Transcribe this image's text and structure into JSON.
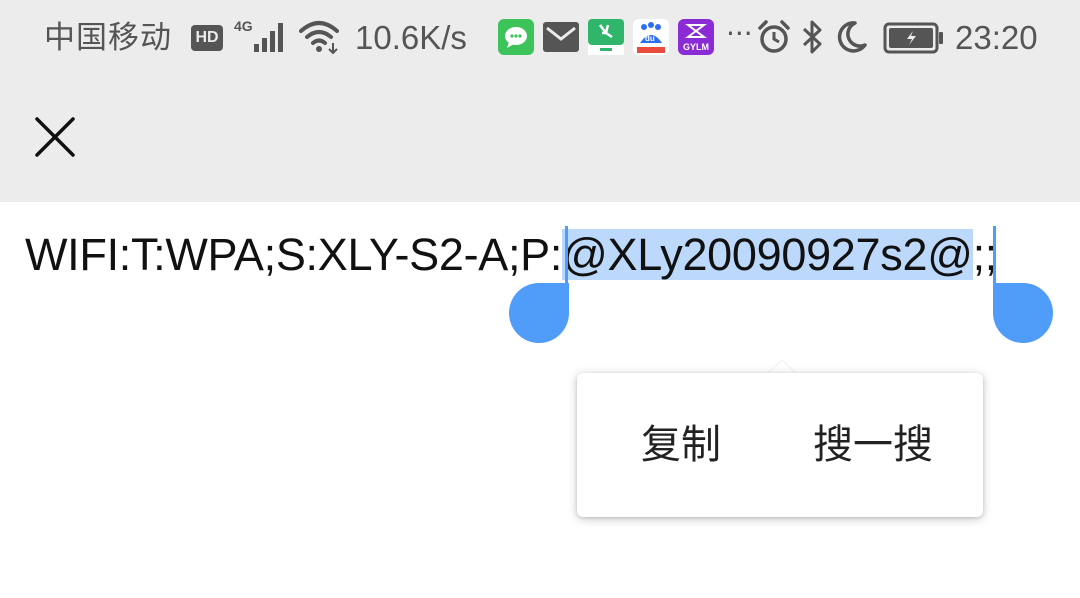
{
  "status_bar": {
    "carrier": "中国移动",
    "hd_badge": "HD",
    "network_type": "4G",
    "net_speed": "10.6K/s",
    "more": "···",
    "time": "23:20",
    "icons": [
      "hd-icon",
      "signal-4g-icon",
      "wifi-icon",
      "wechat-app-icon",
      "mail-app-icon",
      "green-app-icon",
      "baidu-app-icon",
      "gylm-app-icon",
      "alarm-icon",
      "bluetooth-icon",
      "moon-icon",
      "battery-charging-icon"
    ],
    "app_labels": {
      "baidu": "du",
      "gylm": "GYLM"
    }
  },
  "toolbar": {
    "close_icon": "close-icon"
  },
  "content": {
    "text_before": "WIFI:T:WPA;S:XLY-S2-A;P:",
    "selected_text": "@XLy20090927s2@",
    "text_after": ";;"
  },
  "popup_menu": {
    "copy_label": "复制",
    "search_label": "搜一搜"
  },
  "colors": {
    "selection_highlight": "#bcd9fb",
    "handle": "#4f9cf9",
    "toolbar_bg": "#ececec"
  }
}
